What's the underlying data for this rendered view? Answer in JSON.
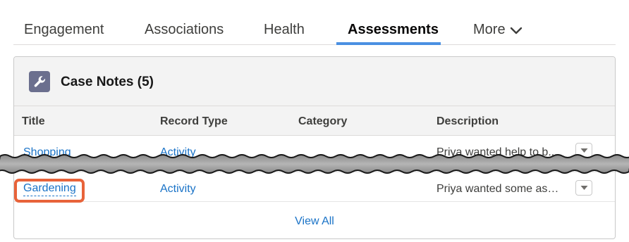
{
  "tabs": [
    {
      "label": "Engagement",
      "active": false
    },
    {
      "label": "Associations",
      "active": false
    },
    {
      "label": "Health",
      "active": false
    },
    {
      "label": "Assessments",
      "active": true
    },
    {
      "label": "More",
      "active": false,
      "icon": "chevron-down-icon"
    }
  ],
  "card": {
    "icon": "wrench-icon",
    "icon_color": "#6b6f8e",
    "title": "Case Notes (5)",
    "columns": [
      "Title",
      "Record Type",
      "Category",
      "Description"
    ],
    "rows": [
      {
        "title": "Shopping",
        "record_type": "Activity",
        "category": "",
        "description": "Priya wanted help to b..."
      },
      {
        "title": "Gardening",
        "record_type": "Activity",
        "category": "",
        "description": "Priya wanted some ass..."
      }
    ],
    "view_all": "View All"
  },
  "colors": {
    "link": "#1a73c7",
    "active_tab_underline": "#4a90e2",
    "highlight": "#e8633a"
  }
}
